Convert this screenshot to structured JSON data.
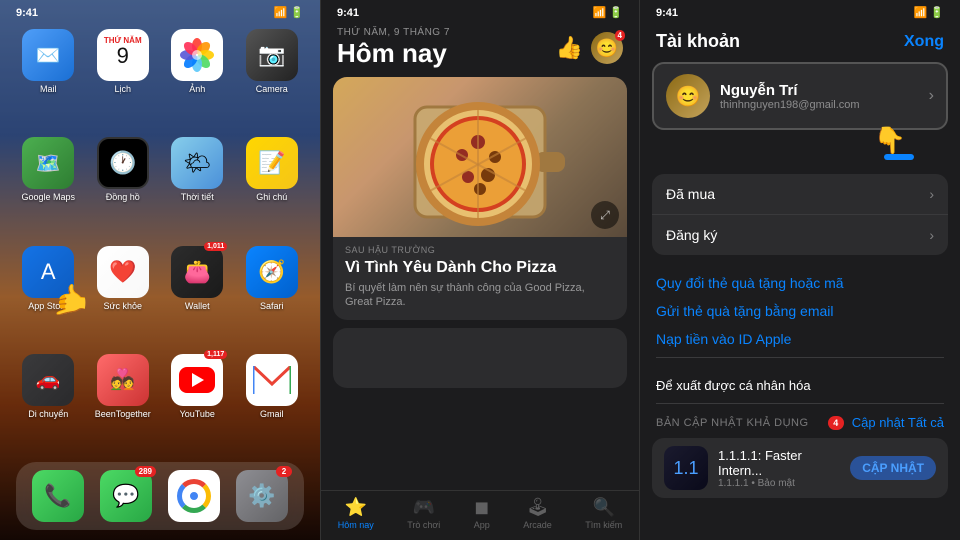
{
  "panel1": {
    "status": {
      "time": "9:41",
      "signal": "●●●",
      "wifi": "▲",
      "battery": "⬜"
    },
    "date_label": "Thứ Năm, 9",
    "apps": [
      {
        "id": "mail",
        "label": "Mail",
        "icon": "mail",
        "badge": null
      },
      {
        "id": "calendar",
        "label": "Lịch",
        "icon": "calendar",
        "badge": null,
        "day": "9"
      },
      {
        "id": "photos",
        "label": "Ảnh",
        "icon": "photos",
        "badge": null
      },
      {
        "id": "camera",
        "label": "Camera",
        "icon": "camera",
        "badge": null
      },
      {
        "id": "maps",
        "label": "Google Maps",
        "icon": "maps",
        "badge": null
      },
      {
        "id": "clock",
        "label": "Đồng hồ",
        "icon": "clock",
        "badge": null
      },
      {
        "id": "weather",
        "label": "Thời tiết",
        "icon": "weather",
        "badge": null
      },
      {
        "id": "notes",
        "label": "Ghi chú",
        "icon": "notes",
        "badge": null
      },
      {
        "id": "appstore",
        "label": "App Store",
        "icon": "appstore",
        "badge": null
      },
      {
        "id": "health",
        "label": "Sức khỏe",
        "icon": "health",
        "badge": null
      },
      {
        "id": "wallet",
        "label": "Wallet",
        "icon": "wallet",
        "badge": "1,011"
      },
      {
        "id": "safari",
        "label": "Safari",
        "icon": "safari",
        "badge": null
      },
      {
        "id": "diChuyen",
        "label": "Di chuyển",
        "icon": "diChuyen",
        "badge": null
      },
      {
        "id": "beentogether",
        "label": "BeenTogether",
        "icon": "beentogether",
        "badge": null
      },
      {
        "id": "youtube",
        "label": "YouTube",
        "icon": "youtube",
        "badge": "1,117"
      },
      {
        "id": "gmail",
        "label": "Gmail",
        "icon": "gmail",
        "badge": null
      }
    ],
    "dock": [
      {
        "id": "phone",
        "label": "Phone",
        "icon": "phone",
        "badge": null
      },
      {
        "id": "messages",
        "label": "Messages",
        "icon": "messages",
        "badge": "289"
      },
      {
        "id": "chrome",
        "label": "Chrome",
        "icon": "chrome",
        "badge": null
      },
      {
        "id": "settings",
        "label": "Settings",
        "icon": "settings",
        "badge": "2"
      }
    ]
  },
  "panel2": {
    "status": {
      "time": "9:41"
    },
    "date_label": "THỨ NĂM, 9 THÁNG 7",
    "title": "Hôm nay",
    "avatar_badge": "4",
    "card": {
      "tag": "SAU HẬU TRƯỜNG",
      "title": "Vì Tình Yêu Dành Cho Pizza",
      "desc": "Bí quyết làm nên sự thành công của Good Pizza, Great Pizza."
    },
    "tabs": [
      {
        "id": "today",
        "label": "Hôm nay",
        "icon": "🏠",
        "active": true
      },
      {
        "id": "games",
        "label": "Trò chơi",
        "icon": "🎮",
        "active": false
      },
      {
        "id": "apps",
        "label": "App",
        "icon": "◼",
        "active": false
      },
      {
        "id": "arcade",
        "label": "Arcade",
        "icon": "🕹",
        "active": false
      },
      {
        "id": "search",
        "label": "Tìm kiếm",
        "icon": "🔍",
        "active": false
      }
    ]
  },
  "panel3": {
    "status": {
      "time": "9:41"
    },
    "title": "Tài khoản",
    "done_label": "Xong",
    "profile": {
      "name": "Nguyễn Trí",
      "email": "thinhnguyen198@gmail.com"
    },
    "rows": [
      {
        "label": "Đã mua",
        "chevron": true
      },
      {
        "label": "Đăng ký",
        "chevron": true
      }
    ],
    "links": [
      "Quy đổi thẻ quà tặng hoặc mã",
      "Gửi thẻ quà tặng bằng email",
      "Nạp tiền vào ID Apple"
    ],
    "personalize_label": "Để xuất được cá nhân hóa",
    "update_section_label": "BẢN CẬP NHẬT KHẢ DỤNG",
    "update_all_label": "Cập nhật Tất cả",
    "update_badge": "4",
    "update_app": {
      "name": "1.1.1.1: Faster Intern...",
      "desc": "1.1.1.1 • Bảo mật",
      "btn": "CẬP NHẬT"
    }
  }
}
